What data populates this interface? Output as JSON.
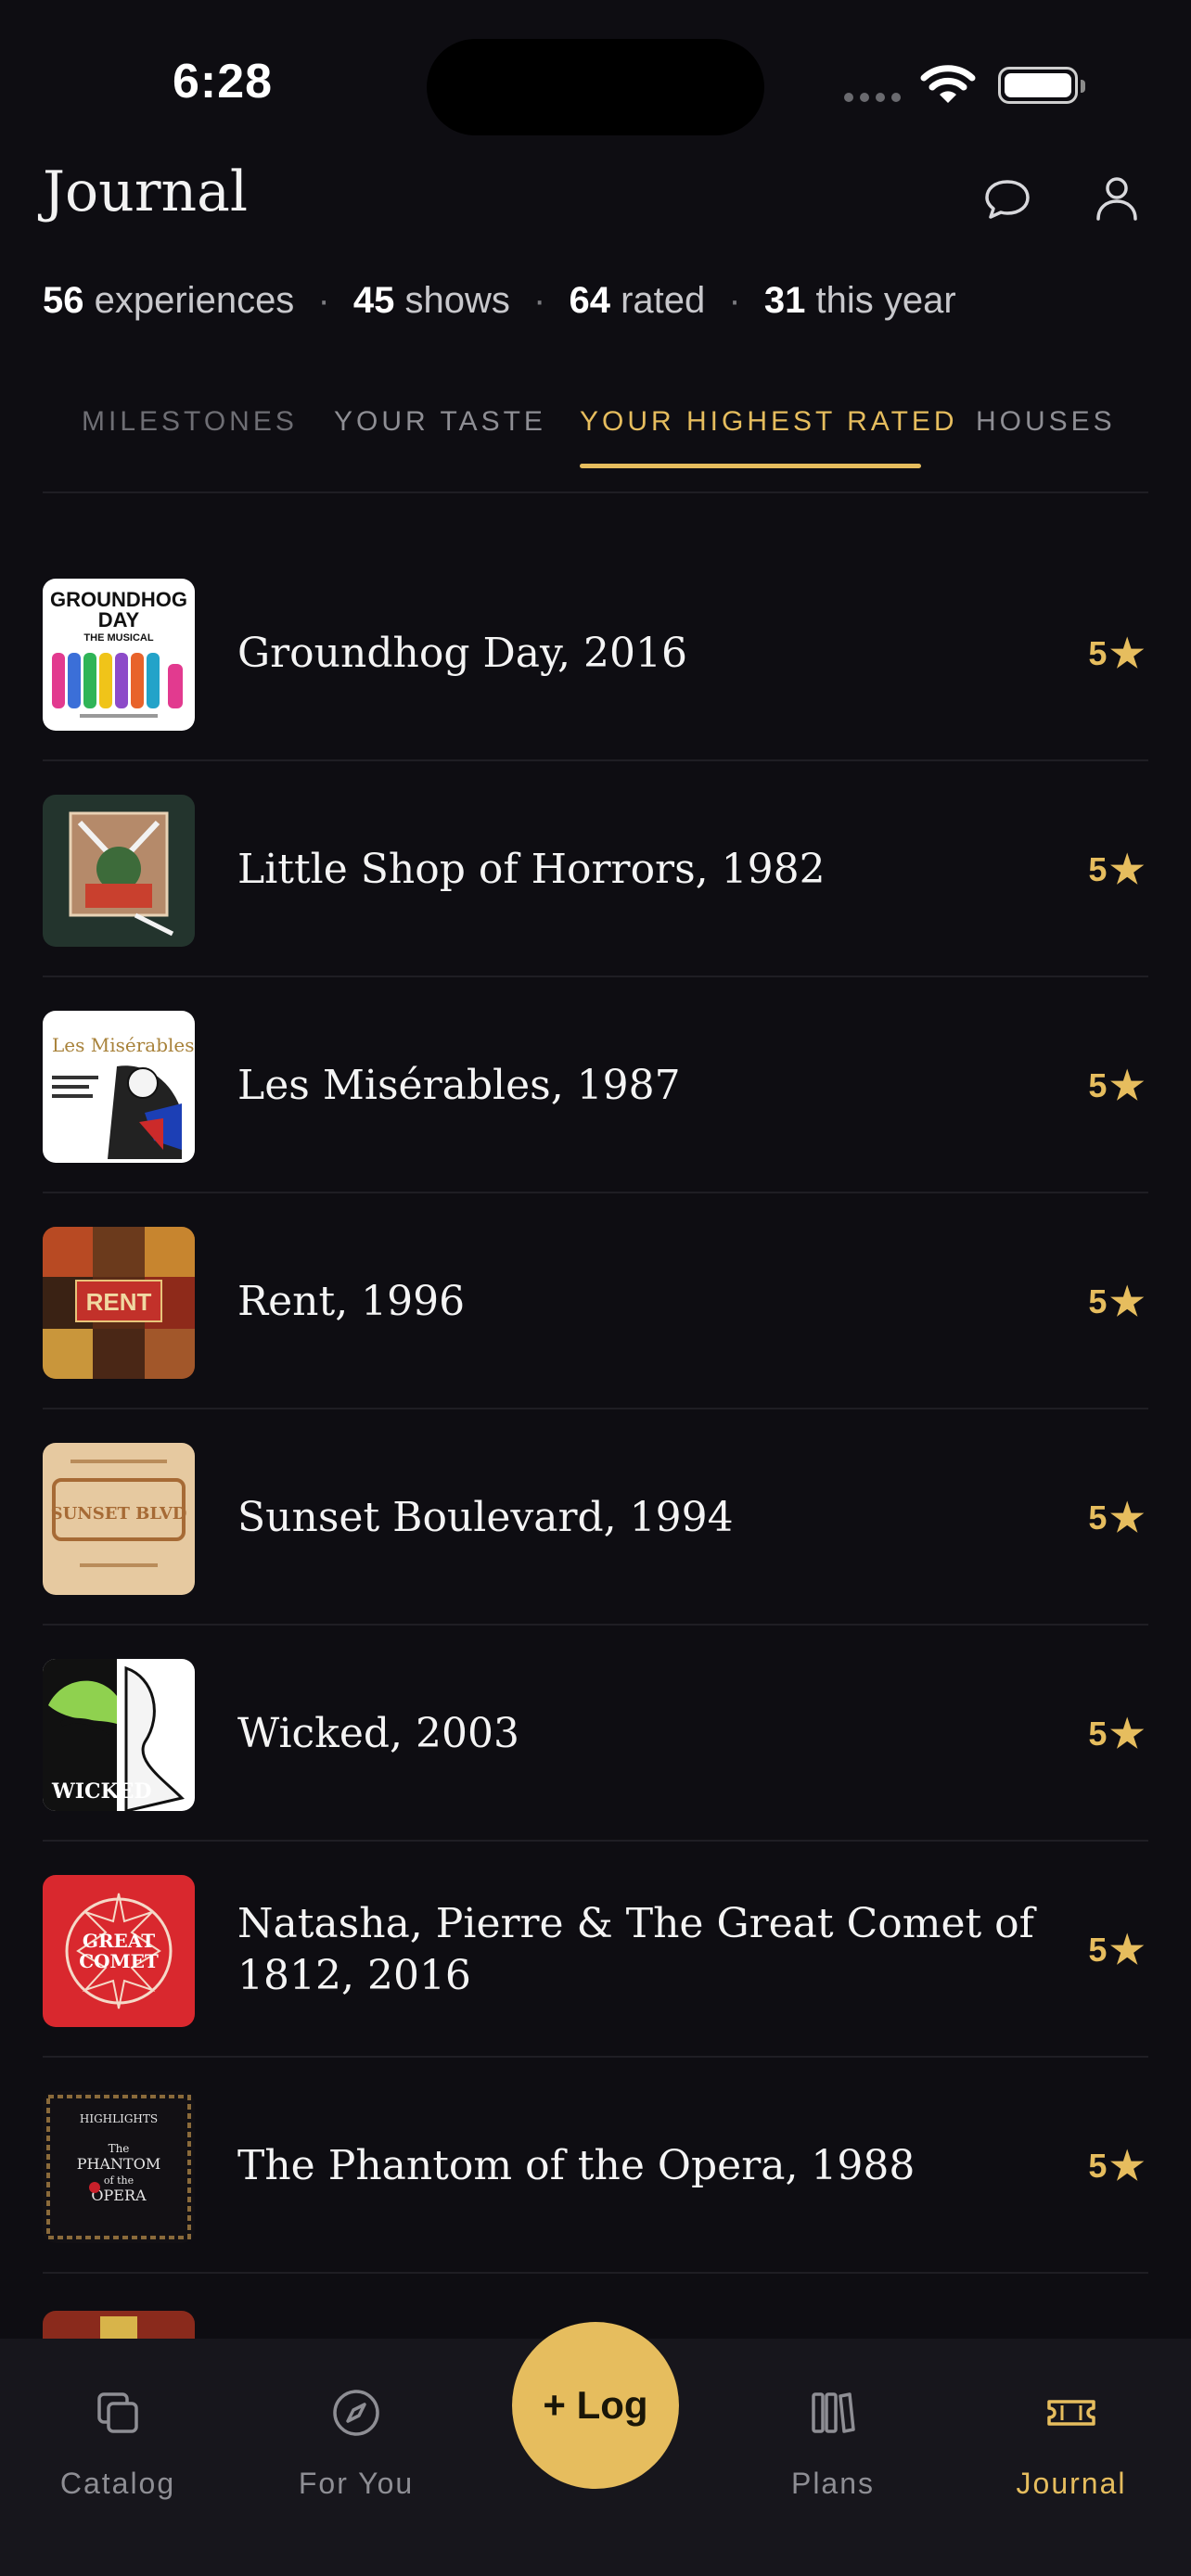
{
  "status_bar": {
    "time": "6:28"
  },
  "header": {
    "title": "Journal"
  },
  "stats": [
    {
      "value": "56",
      "label": "experiences"
    },
    {
      "value": "45",
      "label": "shows"
    },
    {
      "value": "64",
      "label": "rated"
    },
    {
      "value": "31",
      "label": "this year"
    }
  ],
  "tabs": [
    {
      "label": "MILESTONES",
      "active": false
    },
    {
      "label": "YOUR TASTE",
      "active": false
    },
    {
      "label": "YOUR HIGHEST RATED",
      "active": true
    },
    {
      "label": "HOUSES",
      "active": false
    }
  ],
  "items": [
    {
      "title": "Groundhog Day, 2016",
      "rating": "5"
    },
    {
      "title": "Little Shop of Horrors, 1982",
      "rating": "5"
    },
    {
      "title": "Les Misérables, 1987",
      "rating": "5"
    },
    {
      "title": "Rent, 1996",
      "rating": "5"
    },
    {
      "title": "Sunset Boulevard, 1994",
      "rating": "5"
    },
    {
      "title": "Wicked, 2003",
      "rating": "5"
    },
    {
      "title": "Natasha, Pierre & The Great Comet of 1812, 2016",
      "rating": "5"
    },
    {
      "title": "The Phantom of the Opera, 1988",
      "rating": "5"
    }
  ],
  "cover_text": {
    "groundhog": [
      "GROUNDHOG",
      "DAY",
      "THE MUSICAL"
    ],
    "les_mis": "Les Misérables",
    "rent": "RENT",
    "sunset": "SUNSET BLVD",
    "wicked": "WICKED",
    "comet": [
      "GREAT",
      "COMET"
    ],
    "phantom": [
      "HIGHLIGHTS",
      "The",
      "PHANTOM",
      "of the",
      "OPERA"
    ]
  },
  "nav": {
    "catalog": "Catalog",
    "for_you": "For You",
    "log": "+ Log",
    "plans": "Plans",
    "journal": "Journal"
  },
  "colors": {
    "accent": "#e6bd5e",
    "background": "#0e0d12",
    "nav_background": "#17161c"
  }
}
